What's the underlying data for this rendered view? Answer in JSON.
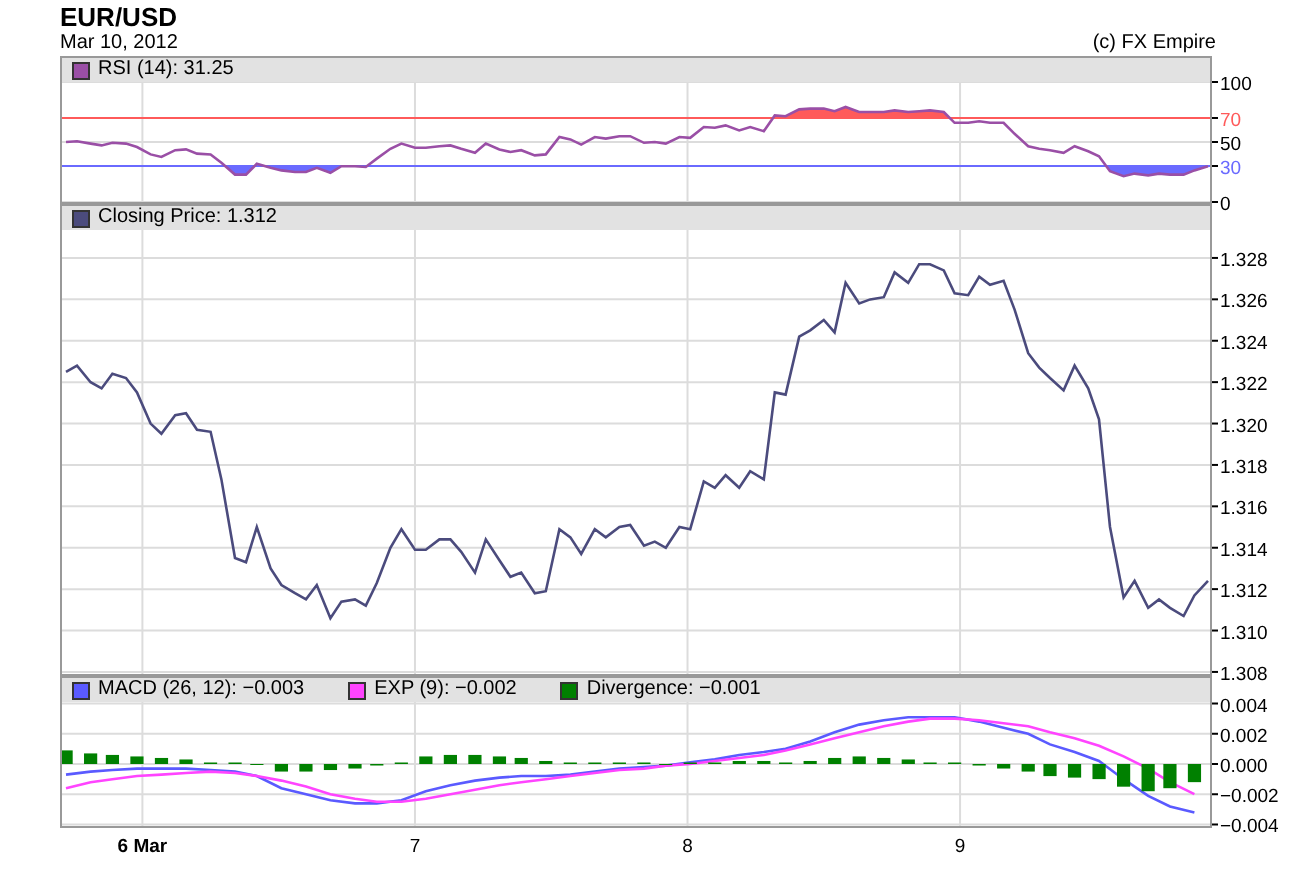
{
  "header": {
    "title": "EUR/USD",
    "date": "Mar 10, 2012",
    "copyright": "(c) FX Empire"
  },
  "panels": [
    {
      "chart_data": {
        "type": "line",
        "grid": true,
        "legend": "top",
        "xlim": [
          5.705,
          9.917
        ],
        "ylim": [
          0,
          100
        ],
        "yticks": [
          {
            "value": 0,
            "label": "0"
          },
          {
            "value": 30,
            "label": "30"
          },
          {
            "value": 50,
            "label": "50"
          },
          {
            "value": 70,
            "label": "70"
          },
          {
            "value": 100,
            "label": "100"
          }
        ],
        "x": [
          5.72,
          5.76,
          5.81,
          5.85,
          5.89,
          5.94,
          5.98,
          6.03,
          6.07,
          6.12,
          6.16,
          6.2,
          6.25,
          6.29,
          6.34,
          6.38,
          6.42,
          6.47,
          6.51,
          6.56,
          6.6,
          6.64,
          6.69,
          6.73,
          6.78,
          6.82,
          6.86,
          6.91,
          6.95,
          7.0,
          7.04,
          7.09,
          7.13,
          7.17,
          7.22,
          7.26,
          7.31,
          7.35,
          7.39,
          7.44,
          7.48,
          7.53,
          7.57,
          7.61,
          7.66,
          7.7,
          7.75,
          7.79,
          7.84,
          7.88,
          7.92,
          7.97,
          8.01,
          8.06,
          8.1,
          8.14,
          8.19,
          8.23,
          8.28,
          8.32,
          8.36,
          8.41,
          8.45,
          8.5,
          8.54,
          8.58,
          8.63,
          8.67,
          8.72,
          8.76,
          8.81,
          8.85,
          8.89,
          8.94,
          8.98,
          9.03,
          9.07,
          9.11,
          9.16,
          9.2,
          9.25,
          9.29,
          9.33,
          9.38,
          9.42,
          9.47,
          9.51,
          9.55,
          9.6,
          9.64,
          9.69,
          9.73,
          9.77,
          9.82,
          9.86,
          9.91
        ],
        "ref_lines": [
          {
            "axis": "y",
            "value": 70,
            "color": "#ff5a5a"
          },
          {
            "axis": "y",
            "value": 30,
            "color": "#6a6aff"
          }
        ],
        "series": [
          {
            "name": "RSI (14): 31.25",
            "color": "#9a4fa6",
            "values": [
              50,
              50.7,
              48.6,
              47.2,
              49.3,
              48.6,
              45.8,
              39.6,
              37.5,
              43.1,
              43.8,
              40.3,
              39.6,
              32.6,
              22.9,
              22.9,
              31.9,
              28.5,
              26.4,
              25,
              25,
              28.5,
              24.3,
              29.9,
              29.9,
              29.2,
              36.1,
              44.4,
              48.6,
              45.1,
              45.1,
              46.5,
              47.2,
              44.4,
              41,
              48.6,
              43.8,
              41.7,
              43.1,
              38.9,
              39.6,
              54.2,
              52.1,
              47.9,
              54.2,
              52.8,
              54.9,
              54.9,
              49.3,
              50,
              48.6,
              54.2,
              53.5,
              62.5,
              61.8,
              63.9,
              59.7,
              62.5,
              59,
              72.2,
              71.5,
              77.1,
              77.8,
              77.8,
              75.7,
              79.2,
              75,
              75,
              75,
              76.4,
              75,
              75.7,
              76.4,
              75,
              66,
              66,
              67.4,
              66,
              66,
              56.9,
              46.5,
              44.4,
              43.1,
              41,
              46.5,
              42.4,
              38.2,
              25.7,
              21.5,
              23.6,
              22.2,
              23.6,
              22.9,
              22.9,
              26.4,
              29.9
            ]
          }
        ]
      }
    },
    {
      "chart_data": {
        "type": "line",
        "grid": true,
        "legend": "top",
        "xlim": [
          5.705,
          9.917
        ],
        "ylim": [
          1.3079,
          1.32935
        ],
        "yticks": [
          {
            "value": 1.308,
            "label": "1.308"
          },
          {
            "value": 1.31,
            "label": "1.310"
          },
          {
            "value": 1.312,
            "label": "1.312"
          },
          {
            "value": 1.314,
            "label": "1.314"
          },
          {
            "value": 1.316,
            "label": "1.316"
          },
          {
            "value": 1.318,
            "label": "1.318"
          },
          {
            "value": 1.32,
            "label": "1.320"
          },
          {
            "value": 1.322,
            "label": "1.322"
          },
          {
            "value": 1.324,
            "label": "1.324"
          },
          {
            "value": 1.326,
            "label": "1.326"
          },
          {
            "value": 1.328,
            "label": "1.328"
          }
        ],
        "x": [
          5.72,
          5.76,
          5.81,
          5.85,
          5.89,
          5.94,
          5.98,
          6.03,
          6.07,
          6.12,
          6.16,
          6.2,
          6.25,
          6.29,
          6.34,
          6.38,
          6.42,
          6.47,
          6.51,
          6.56,
          6.6,
          6.64,
          6.69,
          6.73,
          6.78,
          6.82,
          6.86,
          6.91,
          6.95,
          7.0,
          7.04,
          7.09,
          7.13,
          7.17,
          7.22,
          7.26,
          7.31,
          7.35,
          7.39,
          7.44,
          7.48,
          7.53,
          7.57,
          7.61,
          7.66,
          7.7,
          7.75,
          7.79,
          7.84,
          7.88,
          7.92,
          7.97,
          8.01,
          8.06,
          8.1,
          8.14,
          8.19,
          8.23,
          8.28,
          8.32,
          8.36,
          8.41,
          8.45,
          8.5,
          8.54,
          8.58,
          8.63,
          8.67,
          8.72,
          8.76,
          8.81,
          8.85,
          8.89,
          8.94,
          8.98,
          9.03,
          9.07,
          9.11,
          9.16,
          9.2,
          9.25,
          9.29,
          9.33,
          9.38,
          9.42,
          9.47,
          9.51,
          9.55,
          9.6,
          9.64,
          9.69,
          9.73,
          9.77,
          9.82,
          9.86,
          9.91
        ],
        "series": [
          {
            "name": "Closing Price: 1.312",
            "color": "#4b4b7d",
            "values": [
              1.3225,
              1.3228,
              1.322,
              1.3217,
              1.3224,
              1.3222,
              1.3215,
              1.32,
              1.3195,
              1.3204,
              1.3205,
              1.3197,
              1.3196,
              1.3173,
              1.3135,
              1.3133,
              1.315,
              1.313,
              1.3122,
              1.3118,
              1.3115,
              1.3122,
              1.3106,
              1.3114,
              1.3115,
              1.3112,
              1.3123,
              1.314,
              1.3149,
              1.3139,
              1.3139,
              1.3144,
              1.3144,
              1.3138,
              1.3128,
              1.3144,
              1.3134,
              1.3126,
              1.3128,
              1.3118,
              1.3119,
              1.3149,
              1.3145,
              1.3137,
              1.3149,
              1.3145,
              1.315,
              1.3151,
              1.3141,
              1.3143,
              1.314,
              1.315,
              1.3149,
              1.3172,
              1.3169,
              1.3175,
              1.3169,
              1.3177,
              1.3173,
              1.3215,
              1.3214,
              1.3242,
              1.3245,
              1.325,
              1.3244,
              1.3268,
              1.3258,
              1.326,
              1.3261,
              1.3273,
              1.3268,
              1.3277,
              1.3277,
              1.3274,
              1.3263,
              1.3262,
              1.3271,
              1.3267,
              1.3269,
              1.3255,
              1.3234,
              1.3227,
              1.3222,
              1.3216,
              1.3228,
              1.3217,
              1.3202,
              1.315,
              1.3116,
              1.3124,
              1.3111,
              1.3115,
              1.3111,
              1.3107,
              1.3117,
              1.3124
            ]
          }
        ]
      }
    },
    {
      "chart_data": {
        "type": "line",
        "grid": true,
        "legend": "top",
        "xlim": [
          5.705,
          9.917
        ],
        "ylim": [
          -0.0041,
          0.0041
        ],
        "yticks": [
          {
            "value": -0.004,
            "label": "−0.004"
          },
          {
            "value": -0.002,
            "label": "−0.002"
          },
          {
            "value": 0,
            "label": "0.000"
          },
          {
            "value": 0.002,
            "label": "0.002"
          },
          {
            "value": 0.004,
            "label": "0.004"
          }
        ],
        "xticks": [
          {
            "value": 6,
            "label": "6 Mar"
          },
          {
            "value": 7,
            "label": "7"
          },
          {
            "value": 8,
            "label": "8"
          },
          {
            "value": 9,
            "label": "9"
          }
        ],
        "x": [
          5.72,
          5.81,
          5.89,
          5.98,
          6.07,
          6.16,
          6.25,
          6.34,
          6.42,
          6.51,
          6.6,
          6.69,
          6.78,
          6.86,
          6.95,
          7.04,
          7.13,
          7.22,
          7.31,
          7.39,
          7.48,
          7.57,
          7.66,
          7.75,
          7.84,
          7.92,
          8.01,
          8.1,
          8.19,
          8.28,
          8.36,
          8.45,
          8.54,
          8.63,
          8.72,
          8.81,
          8.89,
          8.98,
          9.07,
          9.16,
          9.25,
          9.33,
          9.42,
          9.51,
          9.6,
          9.69,
          9.77,
          9.86
        ],
        "series": [
          {
            "name": "MACD (26, 12): −0.003",
            "color": "#5a5aff",
            "values": [
              -0.0007,
              -0.0005,
              -0.0004,
              -0.0003,
              -0.0003,
              -0.0003,
              -0.0004,
              -0.0005,
              -0.0008,
              -0.0016,
              -0.002,
              -0.0024,
              -0.0026,
              -0.0026,
              -0.0024,
              -0.0018,
              -0.0014,
              -0.0011,
              -0.0009,
              -0.0008,
              -0.0008,
              -0.0007,
              -0.0005,
              -0.0003,
              -0.0002,
              -0.0001,
              0.0001,
              0.0003,
              0.0006,
              0.0008,
              0.001,
              0.0015,
              0.0021,
              0.0026,
              0.0029,
              0.0031,
              0.0031,
              0.0031,
              0.0028,
              0.0024,
              0.002,
              0.0013,
              0.0008,
              0.0002,
              -0.001,
              -0.0021,
              -0.0028,
              -0.0032
            ]
          },
          {
            "name": "EXP (9): −0.002",
            "color": "#ff44ff",
            "values": [
              -0.0016,
              -0.0012,
              -0.001,
              -0.0008,
              -0.0007,
              -0.0006,
              -0.0005,
              -0.0006,
              -0.0008,
              -0.0011,
              -0.0015,
              -0.002,
              -0.0023,
              -0.0025,
              -0.0025,
              -0.0023,
              -0.002,
              -0.0017,
              -0.0014,
              -0.0012,
              -0.001,
              -0.0008,
              -0.0006,
              -0.0004,
              -0.0003,
              -0.0001,
              0,
              0.0002,
              0.0004,
              0.0006,
              0.0009,
              0.0013,
              0.0017,
              0.0021,
              0.0025,
              0.0028,
              0.003,
              0.003,
              0.0029,
              0.0027,
              0.0025,
              0.0021,
              0.0017,
              0.0012,
              0.0005,
              -0.0003,
              -0.0012,
              -0.002
            ]
          },
          {
            "name": "Divergence: −0.001",
            "color": "#008000",
            "type": "bar",
            "values": [
              0.0009,
              0.0007,
              0.0006,
              0.0005,
              0.0004,
              0.0003,
              0.0001,
              0.0001,
              0,
              -0.0005,
              -0.0005,
              -0.0004,
              -0.0003,
              -0.0001,
              0.0001,
              0.0005,
              0.0006,
              0.0006,
              0.0005,
              0.0004,
              0.0002,
              0.0001,
              0.0001,
              0.0001,
              0.0001,
              0,
              0.0001,
              0.0001,
              0.0002,
              0.0002,
              0.0001,
              0.0002,
              0.0004,
              0.0005,
              0.0004,
              0.0003,
              0.0001,
              0.0001,
              -0.0001,
              -0.0003,
              -0.0005,
              -0.0008,
              -0.0009,
              -0.001,
              -0.0015,
              -0.0018,
              -0.0016,
              -0.0012
            ]
          }
        ]
      }
    }
  ]
}
